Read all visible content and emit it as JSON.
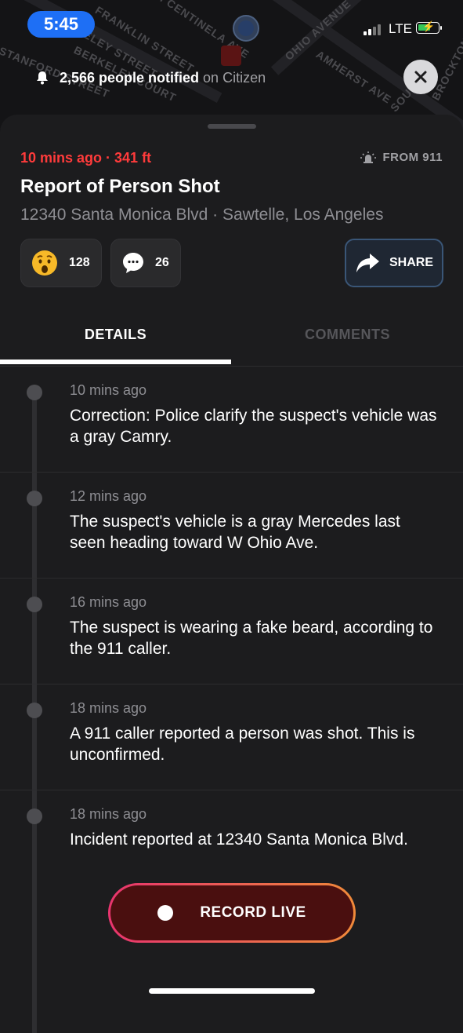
{
  "status_bar": {
    "time": "5:45",
    "network": "LTE"
  },
  "map": {
    "streets": [
      "STANFORD STREET",
      "BERKELEY STREET",
      "FRANKLIN STREET",
      "SOUTH CENTINELA AVE",
      "OHIO AVENUE",
      "AMHERST AVE",
      "SOUTH",
      "BROCKTON AVE",
      "BERKELEY COURT"
    ],
    "notified_count": "2,566 people notified",
    "notified_suffix": "on Citizen"
  },
  "incident": {
    "meta": "10 mins ago · 341 ft",
    "source": "FROM 911",
    "title": "Report of Person Shot",
    "address": "12340 Santa Monica Blvd · Sawtelle, Los Angeles"
  },
  "reactions": {
    "wow_count": "128",
    "comment_count": "26"
  },
  "share_label": "SHARE",
  "tabs": [
    {
      "label": "DETAILS",
      "active": true
    },
    {
      "label": "COMMENTS",
      "active": false
    }
  ],
  "updates": [
    {
      "time": "10 mins ago",
      "text": "Correction: Police clarify the suspect's vehicle was a gray Camry."
    },
    {
      "time": "12 mins ago",
      "text": "The suspect's vehicle is a gray Mercedes last seen heading toward W Ohio Ave."
    },
    {
      "time": "16 mins ago",
      "text": "The suspect is wearing a fake beard, according to the 911 caller."
    },
    {
      "time": "18 mins ago",
      "text": "A 911 caller reported a person was shot. This is unconfirmed."
    },
    {
      "time": "18 mins ago",
      "text": "Incident reported at 12340 Santa Monica Blvd."
    }
  ],
  "record_label": "RECORD LIVE",
  "colors": {
    "alert_red": "#ff3b3b",
    "time_pill": "#1e6ff5",
    "record_gradient_start": "#e8346e",
    "record_gradient_end": "#f08a3a"
  }
}
